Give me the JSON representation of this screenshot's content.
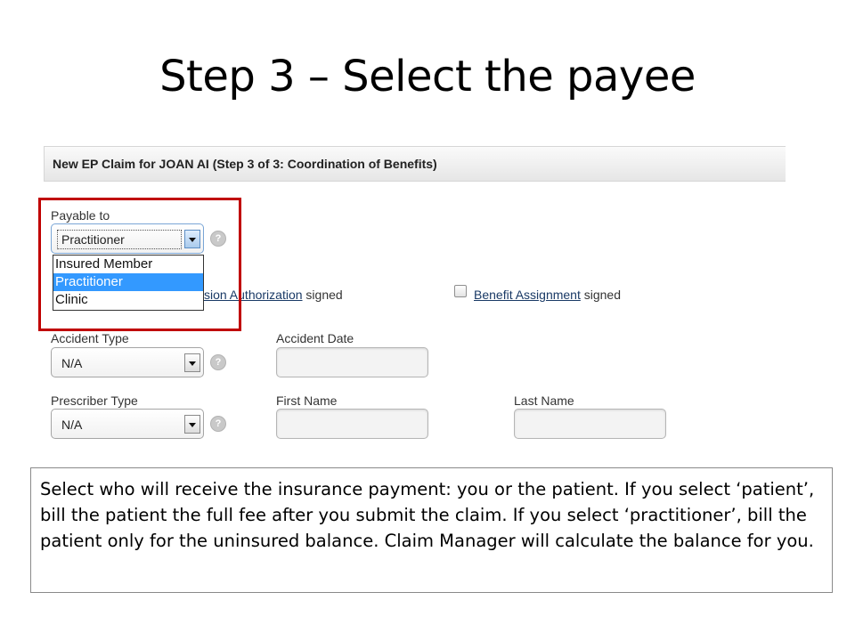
{
  "slide": {
    "title": "Step 3 – Select the payee",
    "caption": "Select who will receive the insurance payment: you or the patient. If you select ‘patient’, bill the patient the full fee after you submit the claim. If you select ‘practitioner’, bill the patient only for the uninsured balance. Claim Manager will calculate the balance for you."
  },
  "form": {
    "header": "New EP Claim for JOAN AI (Step 3 of 3: Coordination of Benefits)",
    "payable_to": {
      "label": "Payable to",
      "value": "Practitioner",
      "options": [
        "Insured Member",
        "Practitioner",
        "Clinic"
      ],
      "selected_index": 1,
      "open": true
    },
    "help_glyph": "?",
    "authorization": {
      "partial_text": "sion Authorization",
      "suffix": "signed"
    },
    "benefit_assignment": {
      "link_text": "Benefit Assignment",
      "suffix": "signed",
      "checked": false
    },
    "accident_type": {
      "label": "Accident Type",
      "value": "N/A"
    },
    "accident_date": {
      "label": "Accident Date",
      "value": ""
    },
    "prescriber_type": {
      "label": "Prescriber Type",
      "value": "N/A"
    },
    "first_name": {
      "label": "First Name",
      "value": ""
    },
    "last_name": {
      "label": "Last Name",
      "value": ""
    }
  },
  "colors": {
    "highlight_border": "#c00000",
    "selected_option": "#3399ff",
    "link": "#1a3a66"
  }
}
